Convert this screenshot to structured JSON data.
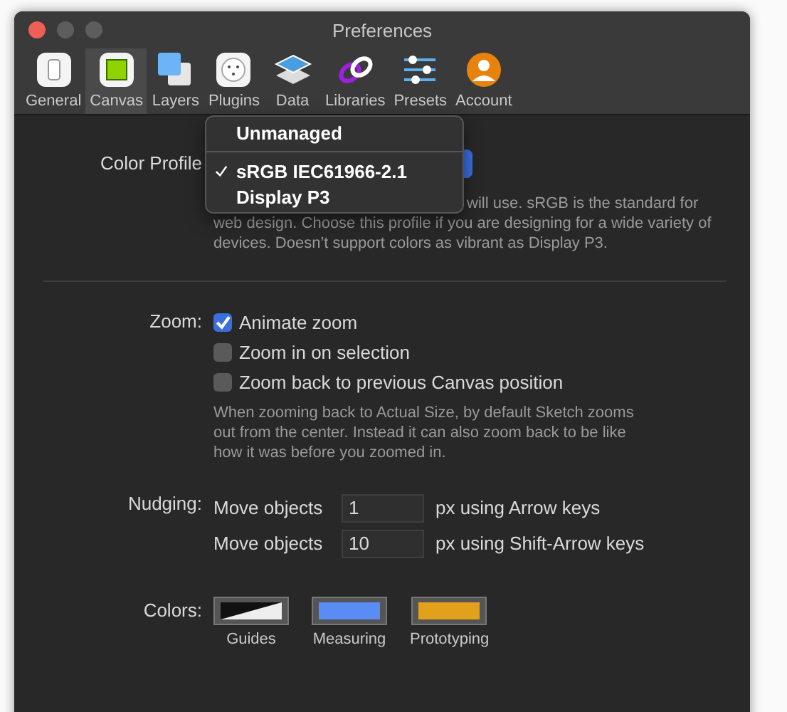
{
  "window": {
    "title": "Preferences"
  },
  "tabs": [
    {
      "label": "General",
      "selected": false
    },
    {
      "label": "Canvas",
      "selected": true
    },
    {
      "label": "Layers",
      "selected": false
    },
    {
      "label": "Plugins",
      "selected": false
    },
    {
      "label": "Data",
      "selected": false
    },
    {
      "label": "Libraries",
      "selected": false
    },
    {
      "label": "Presets",
      "selected": false
    },
    {
      "label": "Account",
      "selected": false
    }
  ],
  "color_profile": {
    "label": "Color Profile",
    "menu": [
      {
        "kind": "item",
        "label": "Unmanaged",
        "checked": false
      },
      {
        "kind": "separator"
      },
      {
        "kind": "item",
        "label": "sRGB IEC61966-2.1",
        "checked": true
      },
      {
        "kind": "item",
        "label": "Display P3",
        "checked": false
      }
    ],
    "description_fragment": "will use. sRGB is the standard for",
    "description": "web design. Choose this profile if you are designing for a wide variety of devices. Doesn’t support colors as vibrant as Display P3."
  },
  "zoom": {
    "label": "Zoom:",
    "options": [
      {
        "label": "Animate zoom",
        "checked": true
      },
      {
        "label": "Zoom in on selection",
        "checked": false
      },
      {
        "label": "Zoom back to previous Canvas position",
        "checked": false
      }
    ],
    "help": "When zooming back to Actual Size, by default Sketch zooms out from the center. Instead it can also zoom back to be like how it was before you zoomed in."
  },
  "nudging": {
    "label": "Nudging:",
    "rows": [
      {
        "label": "Move objects",
        "value": "1",
        "suffix": "px using Arrow keys"
      },
      {
        "label": "Move objects",
        "value": "10",
        "suffix": "px using Shift-Arrow keys"
      }
    ]
  },
  "colors": {
    "label": "Colors:",
    "swatches": [
      {
        "label": "Guides",
        "kind": "split"
      },
      {
        "label": "Measuring",
        "kind": "solid",
        "color": "#5b8cf5"
      },
      {
        "label": "Prototyping",
        "kind": "solid",
        "color": "#e3a01b"
      }
    ]
  }
}
